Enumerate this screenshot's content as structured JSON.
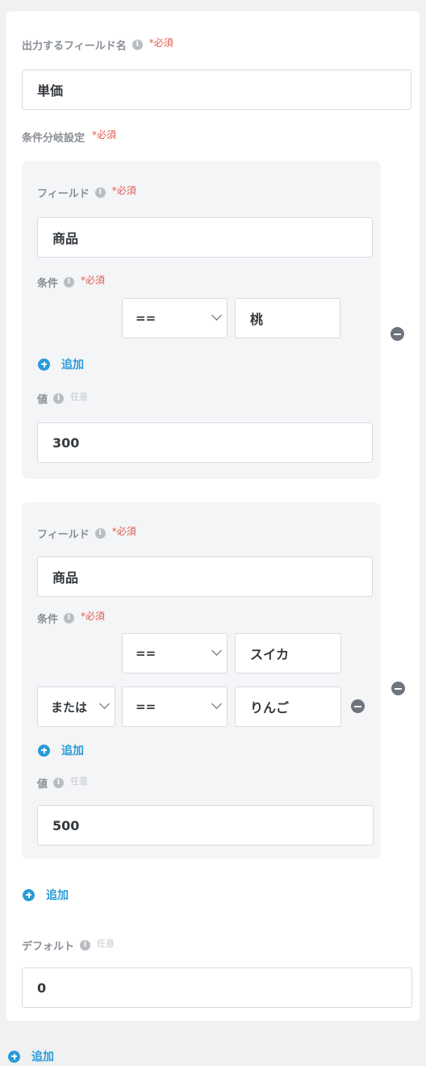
{
  "output_field": {
    "label": "出力するフィールド名",
    "required": "*必須",
    "value": "単価"
  },
  "branch_settings": {
    "label": "条件分岐設定",
    "required": "*必須"
  },
  "branches": [
    {
      "field_label": "フィールド",
      "field_required": "*必須",
      "field_value": "商品",
      "condition_label": "条件",
      "condition_required": "*必須",
      "conditions": [
        {
          "operator": "==",
          "value": "桃"
        }
      ],
      "add_label": "追加",
      "value_label": "値",
      "value_optional": "任意",
      "value": "300"
    },
    {
      "field_label": "フィールド",
      "field_required": "*必須",
      "field_value": "商品",
      "condition_label": "条件",
      "condition_required": "*必須",
      "conditions": [
        {
          "operator": "==",
          "value": "スイカ"
        },
        {
          "logic": "または",
          "operator": "==",
          "value": "りんご"
        }
      ],
      "add_label": "追加",
      "value_label": "値",
      "value_optional": "任意",
      "value": "500"
    }
  ],
  "add_branch_label": "追加",
  "default": {
    "label": "デフォルト",
    "optional": "任意",
    "value": "0"
  },
  "add_outer_label": "追加",
  "colors": {
    "accent": "#2a9bd8",
    "required": "#e05a4f",
    "group_bg": "#f4f5f7"
  },
  "icons": [
    "info-icon",
    "remove-icon",
    "add-icon",
    "chevron-down-icon"
  ]
}
